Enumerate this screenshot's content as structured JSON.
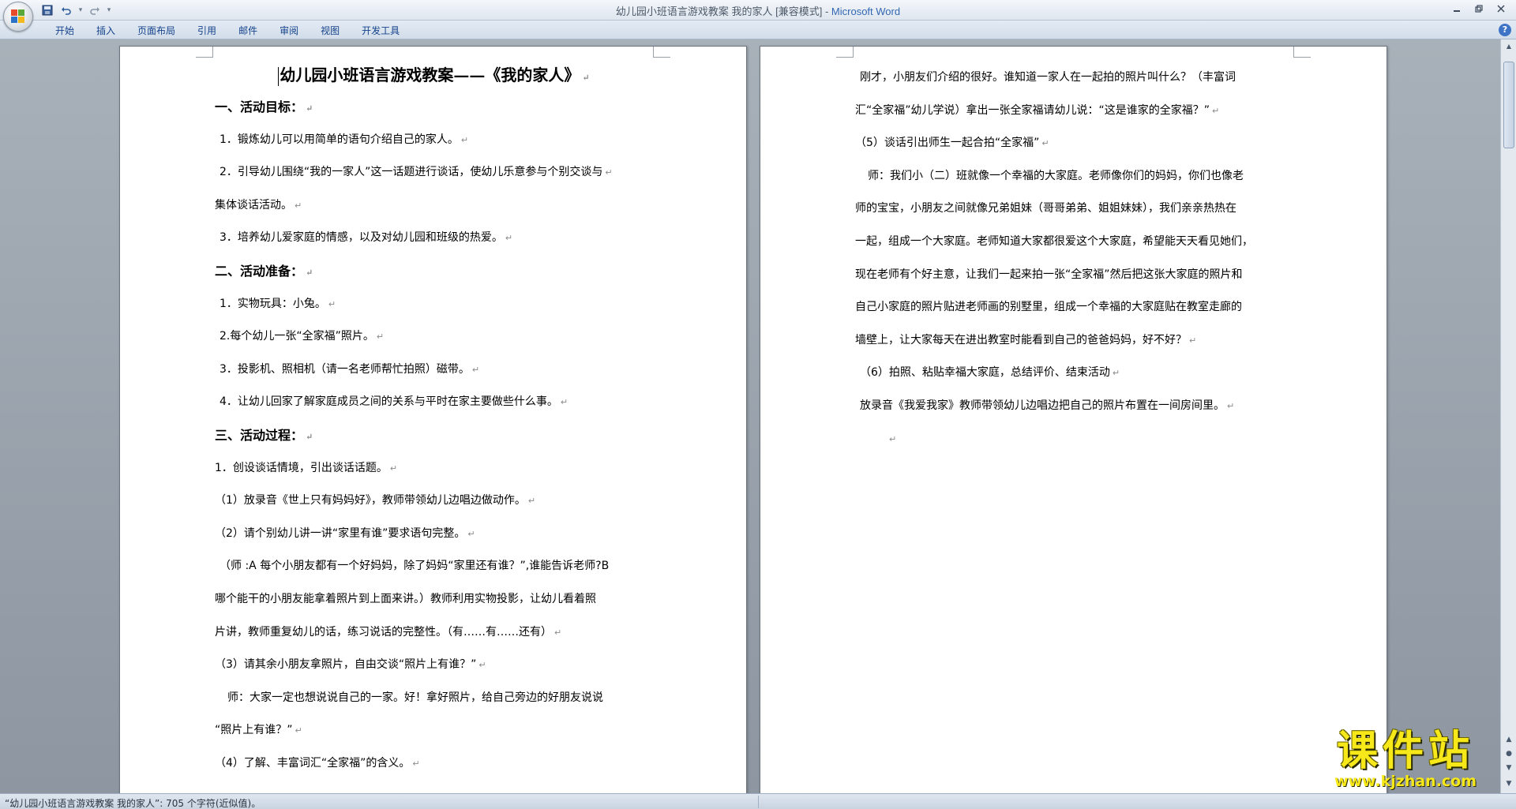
{
  "window": {
    "title": "幼儿园小班语言游戏教案 我的家人 [兼容模式]",
    "app_name": "Microsoft Word",
    "title_separator": " - "
  },
  "quick_access": {
    "save": "save-icon",
    "undo": "undo-icon",
    "redo": "redo-icon",
    "customize": "▾"
  },
  "ribbon_tabs": [
    "开始",
    "插入",
    "页面布局",
    "引用",
    "邮件",
    "审阅",
    "视图",
    "开发工具"
  ],
  "paragraph_mark": "↵",
  "left_page": {
    "title": "幼儿园小班语言游戏教案——《我的家人》",
    "paragraphs": [
      "一、活动目标：",
      "1．锻炼幼儿可以用简单的语句介绍自己的家人。",
      "2．引导幼儿围绕“我的一家人”这一话题进行谈话，使幼儿乐意参与个别交谈与",
      "集体谈话活动。",
      "3．培养幼儿爱家庭的情感，以及对幼儿园和班级的热爱。",
      "二、活动准备：",
      "1．实物玩具：小兔。",
      "2.每个幼儿一张“全家福”照片。",
      "3．投影机、照相机（请一名老师帮忙拍照）磁带。",
      "4．让幼儿回家了解家庭成员之间的关系与平时在家主要做些什么事。",
      "三、活动过程：",
      "1．创设谈话情境，引出谈话话题。",
      "（1）放录音《世上只有妈妈好》，教师带领幼儿边唱边做动作。",
      "（2）请个别幼儿讲一讲“家里有谁”要求语句完整。",
      "（师 :A 每个小朋友都有一个好妈妈，除了妈妈“家里还有谁？”,谁能告诉老师?B",
      "哪个能干的小朋友能拿着照片到上面来讲。）教师利用实物投影，让幼儿看着照",
      "片讲，教师重复幼儿的话，练习说话的完整性。（有……有……还有）",
      "（3）请其余小朋友拿照片，自由交谈“照片上有谁？”",
      "师：大家一定也想说说自己的一家。好！拿好照片，给自己旁边的好朋友说说",
      "“照片上有谁？”",
      "（4）了解、丰富词汇“全家福”的含义。"
    ]
  },
  "right_page": {
    "paragraphs": [
      "刚才，小朋友们介绍的很好。谁知道一家人在一起拍的照片叫什么？（丰富词",
      "汇“全家福”幼儿学说）拿出一张全家福请幼儿说：“这是谁家的全家福？”",
      "（5）谈话引出师生一起合拍“全家福”",
      "师：我们小（二）班就像一个幸福的大家庭。老师像你们的妈妈，你们也像老",
      "师的宝宝，小朋友之间就像兄弟姐妹（哥哥弟弟、姐姐妹妹），我们亲亲热热在",
      "一起，组成一个大家庭。老师知道大家都很爱这个大家庭，希望能天天看见她们，",
      "现在老师有个好主意，让我们一起来拍一张“全家福”然后把这张大家庭的照片和",
      "自己小家庭的照片贴进老师画的别墅里，组成一个幸福的大家庭贴在教室走廊的",
      "墙壁上，让大家每天在进出教室时能看到自己的爸爸妈妈，好不好？",
      "（6）拍照、粘贴幸福大家庭，总结评价、结束活动",
      "放录音《我爱我家》教师带领幼儿边唱边把自己的照片布置在一间房间里。",
      ""
    ]
  },
  "status_bar": {
    "text": "“幼儿园小班语言游戏教案 我的家人”: 705 个字符(近似值)。"
  },
  "watermark": {
    "brand": "课件站",
    "url": "www.kjzhan.com"
  },
  "colors": {
    "ribbon_text": "#15428b",
    "app_name": "#3267b3",
    "watermark": "#f7e81a"
  }
}
